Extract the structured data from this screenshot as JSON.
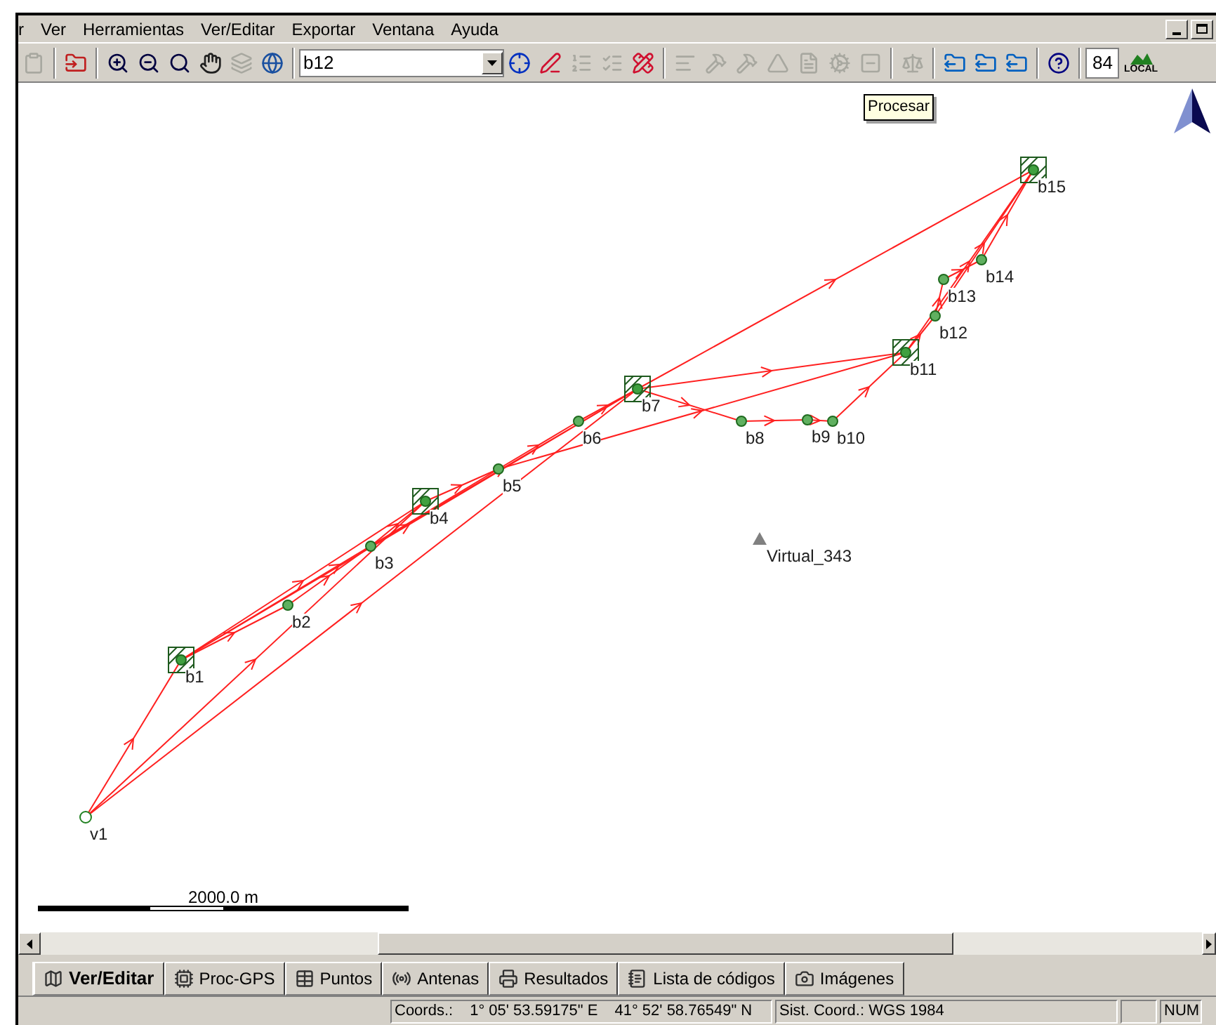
{
  "menu": [
    {
      "label": "r"
    },
    {
      "label": "Ver"
    },
    {
      "label": "Herramientas"
    },
    {
      "label": "Ver/Editar"
    },
    {
      "label": "Exportar"
    },
    {
      "label": "Ventana"
    },
    {
      "label": "Ayuda"
    }
  ],
  "toolbar": {
    "left": [
      {
        "kind": "paste",
        "disabled": true
      },
      {
        "kind": "sep"
      },
      {
        "kind": "import",
        "disabled": false
      },
      {
        "kind": "sep"
      },
      {
        "kind": "zoom-in",
        "disabled": false
      },
      {
        "kind": "zoom-out",
        "disabled": false
      },
      {
        "kind": "zoom-fit",
        "disabled": false
      },
      {
        "kind": "hand",
        "disabled": false
      },
      {
        "kind": "layers",
        "disabled": true
      },
      {
        "kind": "globe",
        "disabled": false
      },
      {
        "kind": "sep"
      }
    ],
    "combo": {
      "value": "b12"
    },
    "right": [
      {
        "kind": "target",
        "disabled": false
      },
      {
        "kind": "pencil",
        "disabled": false
      },
      {
        "kind": "list",
        "disabled": true
      },
      {
        "kind": "list-edit",
        "disabled": true
      },
      {
        "kind": "point-edit",
        "disabled": false
      },
      {
        "kind": "sep"
      },
      {
        "kind": "lines",
        "disabled": true
      },
      {
        "kind": "hammer",
        "disabled": true
      },
      {
        "kind": "hammer",
        "disabled": true
      },
      {
        "kind": "triangle",
        "disabled": true
      },
      {
        "kind": "doc",
        "disabled": true
      },
      {
        "kind": "gear",
        "disabled": true
      },
      {
        "kind": "box",
        "disabled": true
      },
      {
        "kind": "sep"
      },
      {
        "kind": "scale",
        "disabled": true
      },
      {
        "kind": "sep"
      },
      {
        "kind": "export",
        "disabled": false
      },
      {
        "kind": "export",
        "disabled": false
      },
      {
        "kind": "export",
        "disabled": false
      },
      {
        "kind": "sep"
      },
      {
        "kind": "help",
        "disabled": false
      },
      {
        "kind": "sep"
      }
    ],
    "zone": "84",
    "local": "LOCAL"
  },
  "tooltip": "Procesar",
  "points": [
    {
      "label": "v1",
      "kind": "origin"
    },
    {
      "label": "b1",
      "kind": "control"
    },
    {
      "label": "b2",
      "kind": "point"
    },
    {
      "label": "b3",
      "kind": "point"
    },
    {
      "label": "b4",
      "kind": "control"
    },
    {
      "label": "b5",
      "kind": "point"
    },
    {
      "label": "b6",
      "kind": "point"
    },
    {
      "label": "b7",
      "kind": "control"
    },
    {
      "label": "b8",
      "kind": "point"
    },
    {
      "label": "b9",
      "kind": "point"
    },
    {
      "label": "b10",
      "kind": "point"
    },
    {
      "label": "b11",
      "kind": "control"
    },
    {
      "label": "b12",
      "kind": "point"
    },
    {
      "label": "b13",
      "kind": "point"
    },
    {
      "label": "b14",
      "kind": "point"
    },
    {
      "label": "b15",
      "kind": "control"
    },
    {
      "label": "Virtual_343",
      "kind": "virtual"
    }
  ],
  "scale_bar": "2000.0 m",
  "tabs": [
    {
      "label": "Ver/Editar",
      "selected": true
    },
    {
      "label": "Proc-GPS",
      "selected": false
    },
    {
      "label": "Puntos",
      "selected": false
    },
    {
      "label": "Antenas",
      "selected": false
    },
    {
      "label": "Resultados",
      "selected": false
    },
    {
      "label": "Lista de códigos",
      "selected": false
    },
    {
      "label": "Imágenes",
      "selected": false
    }
  ],
  "status": {
    "coords_label": "Coords.:",
    "lon": "1° 05' 53.59175\" E",
    "lat": "41° 52' 58.76549\" N",
    "system": "Sist. Coord.: WGS 1984",
    "num": "NUM"
  }
}
